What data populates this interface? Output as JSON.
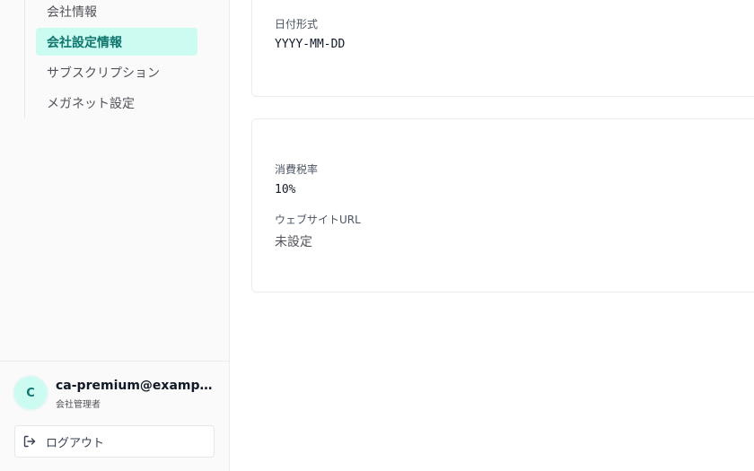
{
  "sidebar": {
    "nav_items": [
      {
        "label": "会社情報",
        "active": false
      },
      {
        "label": "会社設定情報",
        "active": true
      },
      {
        "label": "サブスクリプション",
        "active": false
      },
      {
        "label": "メガネット設定",
        "active": false
      }
    ],
    "user": {
      "avatar_initial": "C",
      "email": "ca-premium@example.com",
      "role": "会社管理者"
    },
    "logout": {
      "label": "ログアウト",
      "icon": "logout-icon"
    }
  },
  "main": {
    "card1": {
      "date_format_label": "日付形式",
      "date_format_value": "YYYY-MM-DD"
    },
    "card2": {
      "tax_rate_label": "消費税率",
      "tax_rate_value": "10%",
      "website_url_label": "ウェブサイトURL",
      "website_url_value": "未設定"
    }
  },
  "colors": {
    "accent": "#0f766e",
    "accent_bg": "#ccfbf1"
  }
}
